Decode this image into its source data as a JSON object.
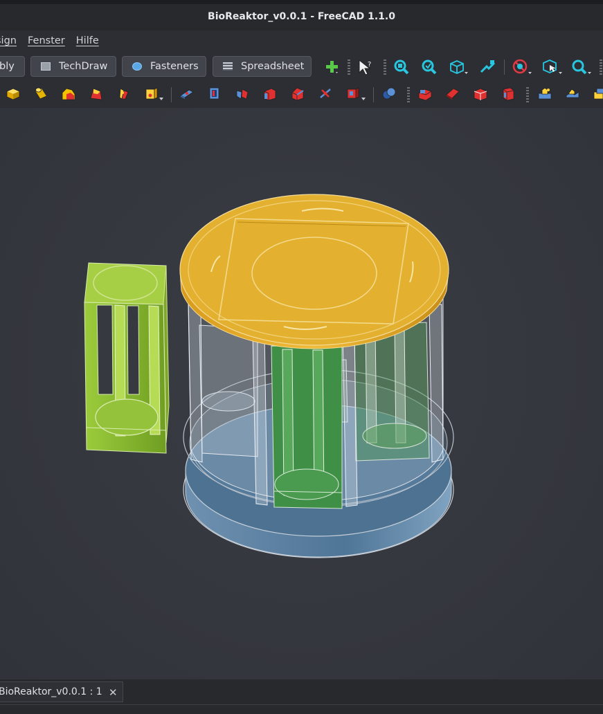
{
  "window": {
    "title": "BioReaktor_v0.0.1 - FreeCAD 1.1.0"
  },
  "menu": {
    "items": [
      "sign",
      "Fenster",
      "Hilfe"
    ]
  },
  "workbenches": {
    "items": [
      "bly",
      "TechDraw",
      "Fasteners",
      "Spreadsheet"
    ]
  },
  "toolbar": {
    "icons": [
      "new-object-icon",
      "select-pointer-icon",
      "zoom-fit-all-icon",
      "zoom-selection-icon",
      "view-isometric-icon",
      "draw-style-icon",
      "no-clip-icon",
      "box-selection-icon",
      "zoom-in-icon"
    ]
  },
  "part_toolbar": {
    "icons": [
      "part-box-icon",
      "part-cylinder-icon",
      "part-cone-icon",
      "part-sphere-icon",
      "part-torus-icon",
      "part-primitives-icon",
      "part-extrude-icon",
      "part-revolve-icon",
      "part-mirror-icon",
      "part-fillet-icon",
      "part-chamfer-icon",
      "part-section-icon",
      "part-cross-section-icon",
      "part-boolean-icon",
      "part-cut-icon",
      "part-fuse-icon",
      "part-common-icon",
      "part-thickness-icon",
      "part-compound-icon",
      "part-shape-builder-icon"
    ]
  },
  "document_tab": {
    "label": "BioReaktor_v0.0.1 : 1",
    "close": "✕"
  },
  "colors": {
    "background": "#2b2d31",
    "viewport": "#363940",
    "lid_yellow": "#e0ae2e",
    "rack_green": "#86b830",
    "holder_green": "#3f8f46",
    "base_blue": "#4c7192"
  }
}
